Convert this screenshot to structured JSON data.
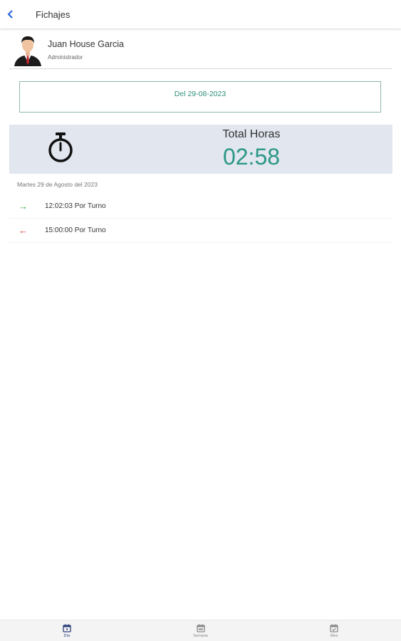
{
  "header": {
    "title": "Fichajes",
    "back_icon": "chevron-left-icon",
    "accent": "#1e5fd6"
  },
  "user": {
    "name": "Juan House Garcia",
    "role": "Administrador"
  },
  "date_filter": {
    "label": "Del 29-08-2023",
    "color": "#2f8f7a"
  },
  "summary": {
    "icon": "stopwatch-icon",
    "label": "Total Horas",
    "value": "02:58",
    "value_color": "#2a9786"
  },
  "day": {
    "label": "Martes 29 de Agosto del 2023"
  },
  "entries": [
    {
      "icon": "arrow-right-icon",
      "direction": "in",
      "color": "#34b34a",
      "text": "12:02:03 Por Turno"
    },
    {
      "icon": "arrow-left-icon",
      "direction": "out",
      "color": "#d83a3a",
      "text": "15:00:00 Por Turno"
    }
  ],
  "bottom_nav": [
    {
      "label": "Día",
      "icon": "calendar-day-icon",
      "active": true
    },
    {
      "label": "Semana",
      "icon": "calendar-week-icon",
      "active": false
    },
    {
      "label": "Mes",
      "icon": "calendar-check-icon",
      "active": false
    }
  ]
}
